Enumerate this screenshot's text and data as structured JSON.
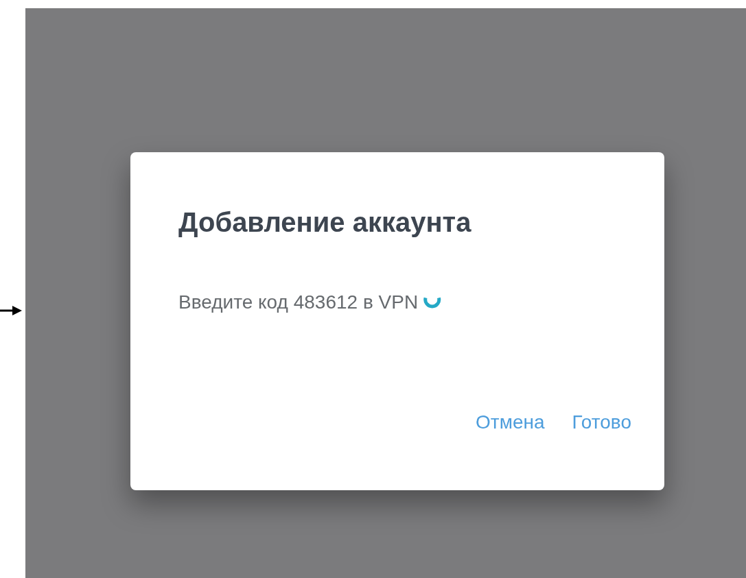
{
  "dialog": {
    "title": "Добавление аккаунта",
    "message": "Введите код 483612 в VPN",
    "buttons": [
      "Отмена",
      "Готово"
    ]
  }
}
